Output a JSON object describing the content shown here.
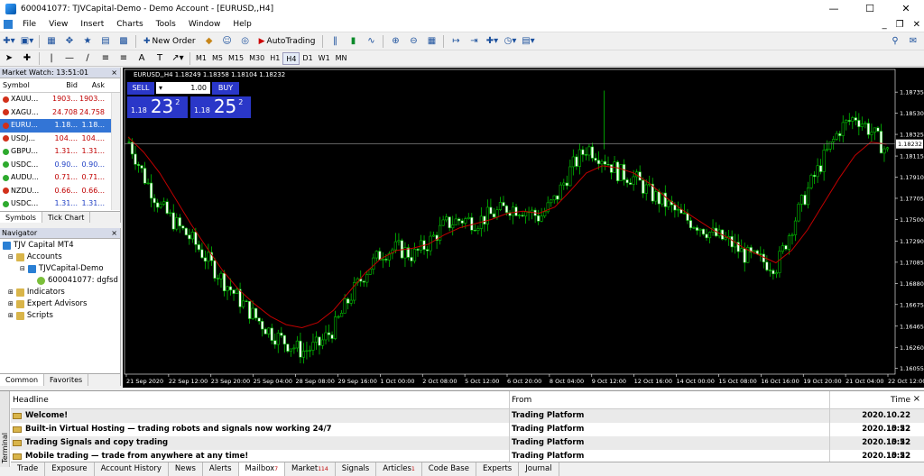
{
  "window": {
    "title": "600041077: TJVCapital-Demo - Demo Account - [EURUSD,,H4]"
  },
  "menu": [
    "File",
    "View",
    "Insert",
    "Charts",
    "Tools",
    "Window",
    "Help"
  ],
  "toolbar": {
    "new_order": "New Order",
    "auto_trading": "AutoTrading"
  },
  "timeframes": [
    "M1",
    "M5",
    "M15",
    "M30",
    "H1",
    "H4",
    "D1",
    "W1",
    "MN"
  ],
  "active_timeframe": "H4",
  "market_watch": {
    "title": "Market Watch: 13:51:01",
    "columns": {
      "symbol": "Symbol",
      "bid": "Bid",
      "ask": "Ask"
    },
    "rows": [
      {
        "symbol": "XAUU...",
        "bid": "1903...",
        "ask": "1903...",
        "icon": "red"
      },
      {
        "symbol": "XAGU...",
        "bid": "24.708",
        "ask": "24.758",
        "icon": "red"
      },
      {
        "symbol": "EURU...",
        "bid": "1.18...",
        "ask": "1.18...",
        "icon": "red"
      },
      {
        "symbol": "USDJ...",
        "bid": "104....",
        "ask": "104....",
        "icon": "red"
      },
      {
        "symbol": "GBPU...",
        "bid": "1.31...",
        "ask": "1.31...",
        "icon": "green"
      },
      {
        "symbol": "USDC...",
        "bid": "0.90...",
        "ask": "0.90...",
        "icon": "green"
      },
      {
        "symbol": "AUDU...",
        "bid": "0.71...",
        "ask": "0.71...",
        "icon": "green"
      },
      {
        "symbol": "NZDU...",
        "bid": "0.66...",
        "ask": "0.66...",
        "icon": "red"
      },
      {
        "symbol": "USDC...",
        "bid": "1.31...",
        "ask": "1.31...",
        "icon": "green"
      }
    ],
    "tabs": [
      "Symbols",
      "Tick Chart"
    ]
  },
  "navigator": {
    "title": "Navigator",
    "root": "TJV Capital MT4",
    "accounts": "Accounts",
    "server": "TJVCapital-Demo",
    "account": "600041077: dgfsd",
    "indicators": "Indicators",
    "experts": "Expert Advisors",
    "scripts": "Scripts",
    "tabs": [
      "Common",
      "Favorites"
    ]
  },
  "chart": {
    "header": "EURUSD,,H4  1.18249 1.18358 1.18104 1.18232",
    "trade_panel": {
      "sell": "SELL",
      "buy": "BUY",
      "lot": "1.00",
      "sell_pre": "1.18",
      "sell_big": "23",
      "sell_sup": "2",
      "buy_pre": "1.18",
      "buy_big": "25",
      "buy_sup": "2"
    },
    "current_price": "1.18232"
  },
  "chart_data": {
    "type": "candlestick",
    "title": "EURUSD,,H4",
    "price_ticks": [
      "1.18735",
      "1.18530",
      "1.18325",
      "1.18115",
      "1.17910",
      "1.17705",
      "1.17500",
      "1.17290",
      "1.17085",
      "1.16880",
      "1.16675",
      "1.16465",
      "1.16260",
      "1.16055"
    ],
    "time_ticks": [
      "21 Sep 2020",
      "22 Sep 12:00",
      "23 Sep 20:00",
      "25 Sep 04:00",
      "28 Sep 08:00",
      "29 Sep 16:00",
      "1 Oct 00:00",
      "2 Oct 08:00",
      "5 Oct 12:00",
      "6 Oct 20:00",
      "8 Oct 04:00",
      "9 Oct 12:00",
      "12 Oct 16:00",
      "14 Oct 00:00",
      "15 Oct 08:00",
      "16 Oct 16:00",
      "19 Oct 20:00",
      "21 Oct 04:00",
      "22 Oct 12:00"
    ],
    "ylim": [
      1.16,
      1.1885
    ],
    "close_path": [
      1.1825,
      1.179,
      1.1762,
      1.1745,
      1.173,
      1.171,
      1.169,
      1.1672,
      1.1655,
      1.164,
      1.163,
      1.1622,
      1.1628,
      1.1645,
      1.1675,
      1.17,
      1.1718,
      1.1722,
      1.1715,
      1.1728,
      1.1745,
      1.175,
      1.1748,
      1.1755,
      1.1762,
      1.176,
      1.1752,
      1.177,
      1.18,
      1.182,
      1.181,
      1.1795,
      1.179,
      1.1775,
      1.1765,
      1.1752,
      1.1745,
      1.1735,
      1.1728,
      1.1715,
      1.171,
      1.1705,
      1.1745,
      1.178,
      1.181,
      1.1838,
      1.185,
      1.1835,
      1.1815
    ],
    "moving_average": [
      1.183,
      1.1815,
      1.1795,
      1.177,
      1.1745,
      1.1722,
      1.17,
      1.1682,
      1.1668,
      1.1656,
      1.1648,
      1.1645,
      1.165,
      1.1662,
      1.168,
      1.1698,
      1.1712,
      1.172,
      1.1722,
      1.1726,
      1.1735,
      1.1742,
      1.1746,
      1.175,
      1.1756,
      1.1758,
      1.1756,
      1.1762,
      1.1778,
      1.1795,
      1.1802,
      1.18,
      1.1795,
      1.1785,
      1.1772,
      1.176,
      1.175,
      1.174,
      1.1732,
      1.1722,
      1.1715,
      1.1708,
      1.172,
      1.174,
      1.1765,
      1.179,
      1.1812,
      1.1825,
      1.1823
    ]
  },
  "terminal": {
    "side_label": "Terminal",
    "columns": {
      "headline": "Headline",
      "from": "From",
      "time": "Time"
    },
    "rows": [
      {
        "headline": "Welcome!",
        "from": "Trading Platform",
        "time": "2020.10.22 15:52"
      },
      {
        "headline": "Built-in Virtual Hosting — trading robots and signals now working 24/7",
        "from": "Trading Platform",
        "time": "2020.10.22 15:52"
      },
      {
        "headline": "Trading Signals and copy trading",
        "from": "Trading Platform",
        "time": "2020.10.22 15:52"
      },
      {
        "headline": "Mobile trading — trade from anywhere at any time!",
        "from": "Trading Platform",
        "time": "2020.10.22 15:52"
      }
    ],
    "tabs": [
      {
        "label": "Trade",
        "badge": ""
      },
      {
        "label": "Exposure",
        "badge": ""
      },
      {
        "label": "Account History",
        "badge": ""
      },
      {
        "label": "News",
        "badge": ""
      },
      {
        "label": "Alerts",
        "badge": ""
      },
      {
        "label": "Mailbox",
        "badge": "7"
      },
      {
        "label": "Market",
        "badge": "114"
      },
      {
        "label": "Signals",
        "badge": ""
      },
      {
        "label": "Articles",
        "badge": "1"
      },
      {
        "label": "Code Base",
        "badge": ""
      },
      {
        "label": "Experts",
        "badge": ""
      },
      {
        "label": "Journal",
        "badge": ""
      }
    ]
  },
  "colors": {
    "bull": "#00c000",
    "bear": "#00c000",
    "ma": "#c00000",
    "panel": "#2a37c8",
    "selection": "#3375d6"
  }
}
